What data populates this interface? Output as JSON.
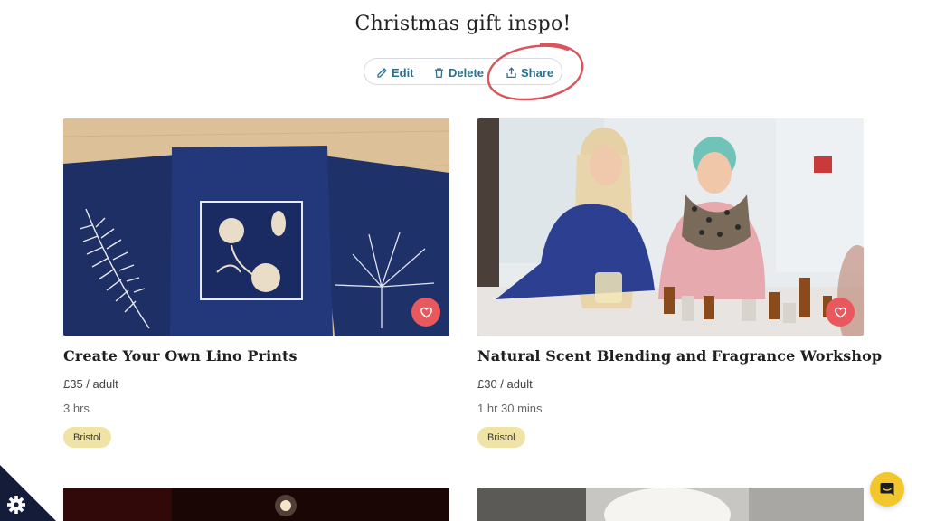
{
  "page": {
    "title": "Christmas gift inspo!"
  },
  "actions": {
    "edit_label": "Edit",
    "delete_label": "Delete",
    "share_label": "Share"
  },
  "colors": {
    "action_text": "#2d6f8e",
    "heart": "#e9585c",
    "tag_bg": "#efe3a6",
    "annotation": "#d9555b",
    "chat": "#f2c72c"
  },
  "cards": [
    {
      "title": "Create Your Own Lino Prints",
      "price": "£35 / adult",
      "duration": "3 hrs",
      "tag": "Bristol"
    },
    {
      "title": "Natural Scent Blending and Fragrance Workshop",
      "price": "£30 / adult",
      "duration": "1 hr 30 mins",
      "tag": "Bristol"
    }
  ],
  "icons": {
    "edit": "pencil-icon",
    "delete": "trash-icon",
    "share": "share-upload-icon",
    "favourite": "heart-icon",
    "cookie": "gear-icon",
    "chat": "chat-icon"
  }
}
